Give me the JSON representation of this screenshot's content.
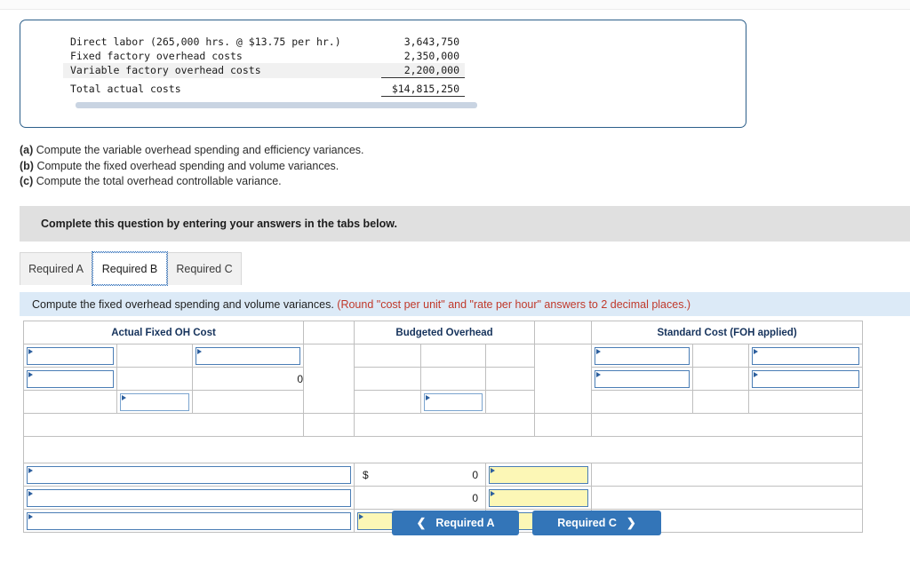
{
  "fact_panel": {
    "rows": [
      {
        "label": "Direct labor (265,000 hrs. @ $13.75 per hr.)",
        "amount": "3,643,750"
      },
      {
        "label": "Fixed factory overhead costs",
        "amount": "2,350,000"
      },
      {
        "label": "Variable factory overhead costs",
        "amount": "2,200,000"
      },
      {
        "label": "Total actual costs",
        "amount": "$14,815,250"
      }
    ]
  },
  "requirements": {
    "a_marker": "(a)",
    "a_text": "Compute the variable overhead spending and efficiency variances.",
    "b_marker": "(b)",
    "b_text": "Compute the fixed overhead spending and volume variances.",
    "c_marker": "(c)",
    "c_text": "Compute the total overhead controllable variance."
  },
  "complete_banner": {
    "text": "Complete this question by entering your answers in the tabs below."
  },
  "tabs": [
    {
      "label": "Required A",
      "active": false
    },
    {
      "label": "Required B",
      "active": true
    },
    {
      "label": "Required C",
      "active": false
    }
  ],
  "sub_instruction": {
    "main": "Compute the fixed overhead spending and volume variances. ",
    "note": "(Round \"cost per unit\" and \"rate per hour\" answers to 2 decimal places.)"
  },
  "worksheet": {
    "headers": {
      "actual": "Actual Fixed OH Cost",
      "budgeted": "Budgeted Overhead",
      "standard": "Standard Cost (FOH applied)"
    },
    "actual_section": {
      "r1c1": "",
      "r1c3": "",
      "r2c1": "",
      "r2c3_value": "0",
      "r3c2": ""
    },
    "budgeted_section": {
      "r3c2": ""
    },
    "standard_section": {
      "r1c1": "",
      "r1c3": "",
      "r2c1": "",
      "r2c3": ""
    },
    "variance_rows": [
      {
        "label": "",
        "currency": "$",
        "amount": "0",
        "result": ""
      },
      {
        "label": "",
        "currency": "",
        "amount": "0",
        "result": ""
      },
      {
        "label": "",
        "currency": "",
        "amount": "",
        "result": ""
      }
    ]
  },
  "nav": {
    "prev_label": "Required A",
    "prev_icon": "chevron-left",
    "next_label": "Required C",
    "next_icon": "chevron-right"
  },
  "colors": {
    "header_blue": "#76a5db",
    "banner_grey": "#e0e0e0",
    "instruction_blue": "#dceaf7",
    "note_red": "#c0392b",
    "input_yellow": "#fcf7b6",
    "button_blue": "#3375b8"
  }
}
